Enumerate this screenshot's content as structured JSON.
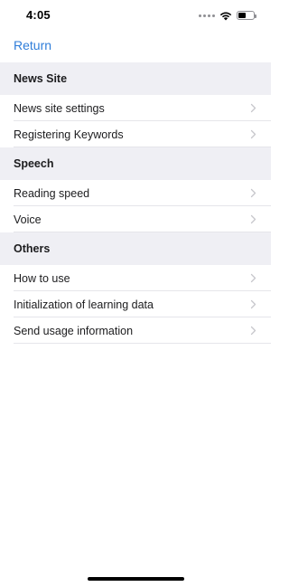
{
  "status_bar": {
    "time": "4:05",
    "icons": [
      "signal-dots-icon",
      "wifi-icon",
      "battery-icon"
    ],
    "battery_level": 0.5
  },
  "nav": {
    "return_label": "Return",
    "accent_color": "#2f7dd9"
  },
  "sections": [
    {
      "header": "News Site",
      "items": [
        "News site settings",
        "Registering Keywords"
      ]
    },
    {
      "header": "Speech",
      "items": [
        "Reading speed",
        "Voice"
      ]
    },
    {
      "header": "Others",
      "items": [
        "How to use",
        "Initialization of learning data",
        "Send usage information"
      ]
    }
  ],
  "colors": {
    "section_bg": "#efeff4",
    "separator": "#e5e5ea",
    "chevron": "#c7c7cc"
  }
}
